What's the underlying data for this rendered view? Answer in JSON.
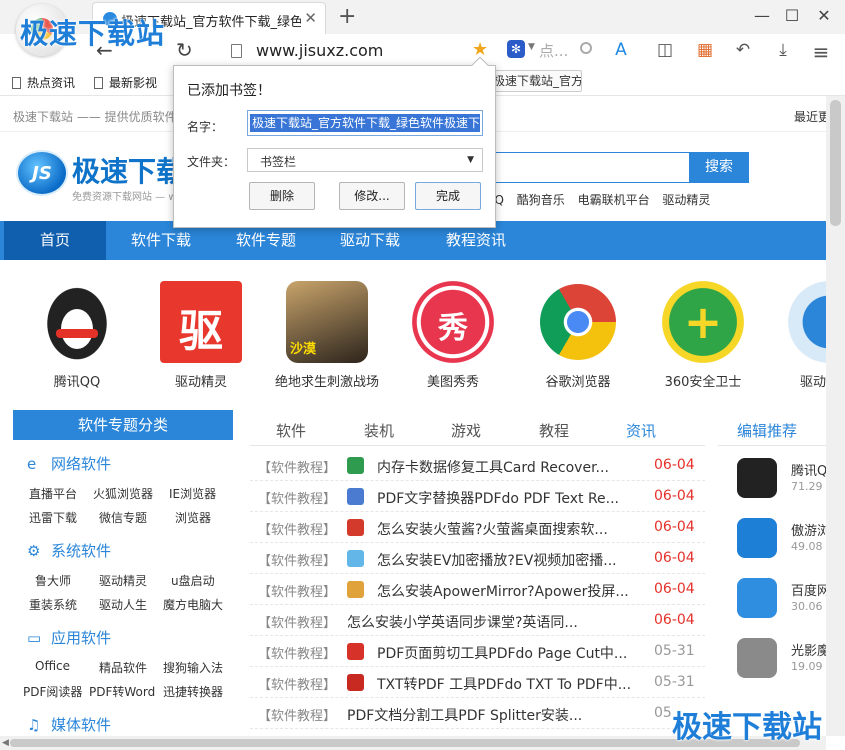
{
  "watermark": "极速下载站",
  "browser": {
    "tab_title": "极速下载站_官方软件下载_绿色软件",
    "tab_close": "✕",
    "new_tab": "+",
    "window_controls": [
      "—",
      "☐",
      "✕"
    ],
    "nav": {
      "back": "←",
      "forward": "→",
      "refresh": "↻"
    },
    "url": "www.jisuxz.com",
    "search_placeholder": "点...",
    "toolbar_icons": [
      "shield-icon",
      "reader-icon",
      "apps-icon",
      "undo-icon",
      "download-icon",
      "menu-icon"
    ],
    "toolbar_glyphs": [
      "A",
      "◫",
      "▦",
      "↶",
      "⤓",
      "≡"
    ]
  },
  "bookmarks_bar": {
    "items": [
      "热点资讯",
      "最新影视"
    ],
    "nav_arrows": [
      "<",
      ">"
    ],
    "highlighted": "极速下载站_官方软件"
  },
  "bookmark_popup": {
    "title": "已添加书签！",
    "name_label": "名字：",
    "name_value": "极速下载站_官方软件下载_绿色软件极速下载站",
    "folder_label": "文件夹：",
    "folder_value": "书签栏",
    "delete_button": "删除",
    "edit_button": "修改...",
    "done_button": "完成"
  },
  "site": {
    "topstrip_left": "极速下载站 —— 提供优质软件",
    "topstrip_right": "最近更",
    "logo_text": "JS",
    "name": "极速下载",
    "slogan": "免费资源下载网站 — www",
    "search_button": "搜索",
    "hotlinks": [
      "QQ",
      "酷狗音乐",
      "电霸联机平台",
      "驱动精灵"
    ],
    "nav": [
      "首页",
      "软件下载",
      "软件专题",
      "驱动下载",
      "教程资讯"
    ],
    "apps": [
      {
        "name": "腾讯QQ",
        "icon": "qq-icon"
      },
      {
        "name": "驱动精灵",
        "icon": "qudong-icon",
        "glyph": "驱"
      },
      {
        "name": "绝地求生刺激战场",
        "icon": "pubg-icon",
        "glyph": "沙漠"
      },
      {
        "name": "美图秀秀",
        "icon": "meitu-icon",
        "glyph": "秀"
      },
      {
        "name": "谷歌浏览器",
        "icon": "chrome-icon"
      },
      {
        "name": "360安全卫士",
        "icon": "safe360-icon",
        "glyph": "+"
      },
      {
        "name": "驱动",
        "icon": "driver-icon"
      }
    ],
    "topics_header": "软件专题分类",
    "categories": [
      {
        "title": "网络软件",
        "glyph": "e",
        "links": [
          "直播平台",
          "火狐浏览器",
          "IE浏览器",
          "迅雷下载",
          "微信专题",
          "浏览器"
        ]
      },
      {
        "title": "系统软件",
        "glyph": "⚙",
        "links": [
          "鲁大师",
          "驱动精灵",
          "u盘启动",
          "重装系统",
          "驱动人生",
          "魔方电脑大"
        ]
      },
      {
        "title": "应用软件",
        "glyph": "▭",
        "links": [
          "Office",
          "精品软件",
          "搜狗输入法",
          "PDF阅读器",
          "PDF转Word",
          "迅捷转换器"
        ]
      },
      {
        "title": "媒体软件",
        "glyph": "♫",
        "links": []
      }
    ],
    "mid_tabs": [
      "软件",
      "装机",
      "游戏",
      "教程",
      "资讯"
    ],
    "news": [
      {
        "cat": "【软件教程】",
        "title": "内存卡数据修复工具Card Recover...",
        "date": "06-04",
        "color": "#2e9b4f"
      },
      {
        "cat": "【软件教程】",
        "title": "PDF文字替换器PDFdo PDF Text Re...",
        "date": "06-04",
        "color": "#4a7bd1"
      },
      {
        "cat": "【软件教程】",
        "title": "怎么安装火萤酱?火萤酱桌面搜索软...",
        "date": "06-04",
        "color": "#d33a2c"
      },
      {
        "cat": "【软件教程】",
        "title": "怎么安装EV加密播放?EV视频加密播...",
        "date": "06-04",
        "color": "#62b6e8"
      },
      {
        "cat": "【软件教程】",
        "title": "怎么安装ApowerMirror?Apower投屏...",
        "date": "06-04",
        "color": "#e0a23a"
      },
      {
        "cat": "【软件教程】",
        "title": "怎么安装小学英语同步课堂?英语同...",
        "date": "06-04",
        "color": ""
      },
      {
        "cat": "【软件教程】",
        "title": "PDF页面剪切工具PDFdo Page Cut中...",
        "date": "05-31",
        "color": "#d6322a"
      },
      {
        "cat": "【软件教程】",
        "title": "TXT转PDF 工具PDFdo TXT To PDF中...",
        "date": "05-31",
        "color": "#c82a22"
      },
      {
        "cat": "【软件教程】",
        "title": "PDF文档分割工具PDF Splitter安装...",
        "date": "05",
        "color": ""
      }
    ],
    "recommend_header": "编辑推荐",
    "recommend": [
      {
        "name": "腾讯Q",
        "size": "71.29",
        "color": "#222"
      },
      {
        "name": "傲游浏",
        "size": "49.08",
        "color": "#1e7fd6"
      },
      {
        "name": "百度网",
        "size": "30.06",
        "color": "#2f8ee0"
      },
      {
        "name": "光影魔",
        "size": "19.09",
        "color": "#8a8a8a"
      }
    ]
  }
}
